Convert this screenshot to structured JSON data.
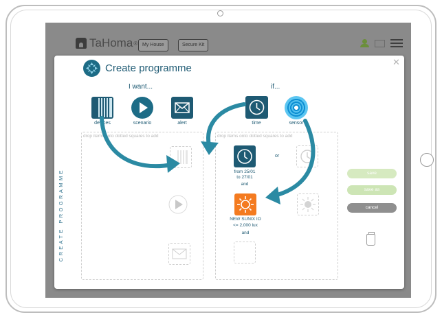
{
  "brand": "TaHoma",
  "header": {
    "my_house_label": "My House",
    "secure_kit_label": "Secure Kit"
  },
  "modal": {
    "title": "Create programme",
    "i_want_label": "I want...",
    "if_label": "if...",
    "side_title": "CREATE PROGRAMME",
    "actions": [
      {
        "label": "devices",
        "icon": "devices-icon"
      },
      {
        "label": "scenario",
        "icon": "play-icon"
      },
      {
        "label": "alert",
        "icon": "envelope-icon"
      }
    ],
    "conditions": [
      {
        "label": "time",
        "icon": "clock-icon"
      },
      {
        "label": "sensor",
        "icon": "sensor-icon"
      }
    ],
    "left_drop_hint": "drop items onto dotted squares to add",
    "right_drop_hint": "drop items onto dotted squares to add",
    "rule_time": {
      "line1": "from 25/01",
      "line2": "to 27/01",
      "connector": "and"
    },
    "rule_sensor": {
      "line1": "NEW SUNIX IO",
      "line2": "<= 2,000 lux",
      "connector": "and"
    },
    "or_label": "or",
    "buttons": {
      "save": "save",
      "save_as": "save as",
      "cancel": "cancel"
    }
  },
  "colors": {
    "primary": "#1e5a73",
    "accent_orange": "#f47b20",
    "save_green": "#d6eac0",
    "cancel_gray": "#8f8f8f"
  }
}
